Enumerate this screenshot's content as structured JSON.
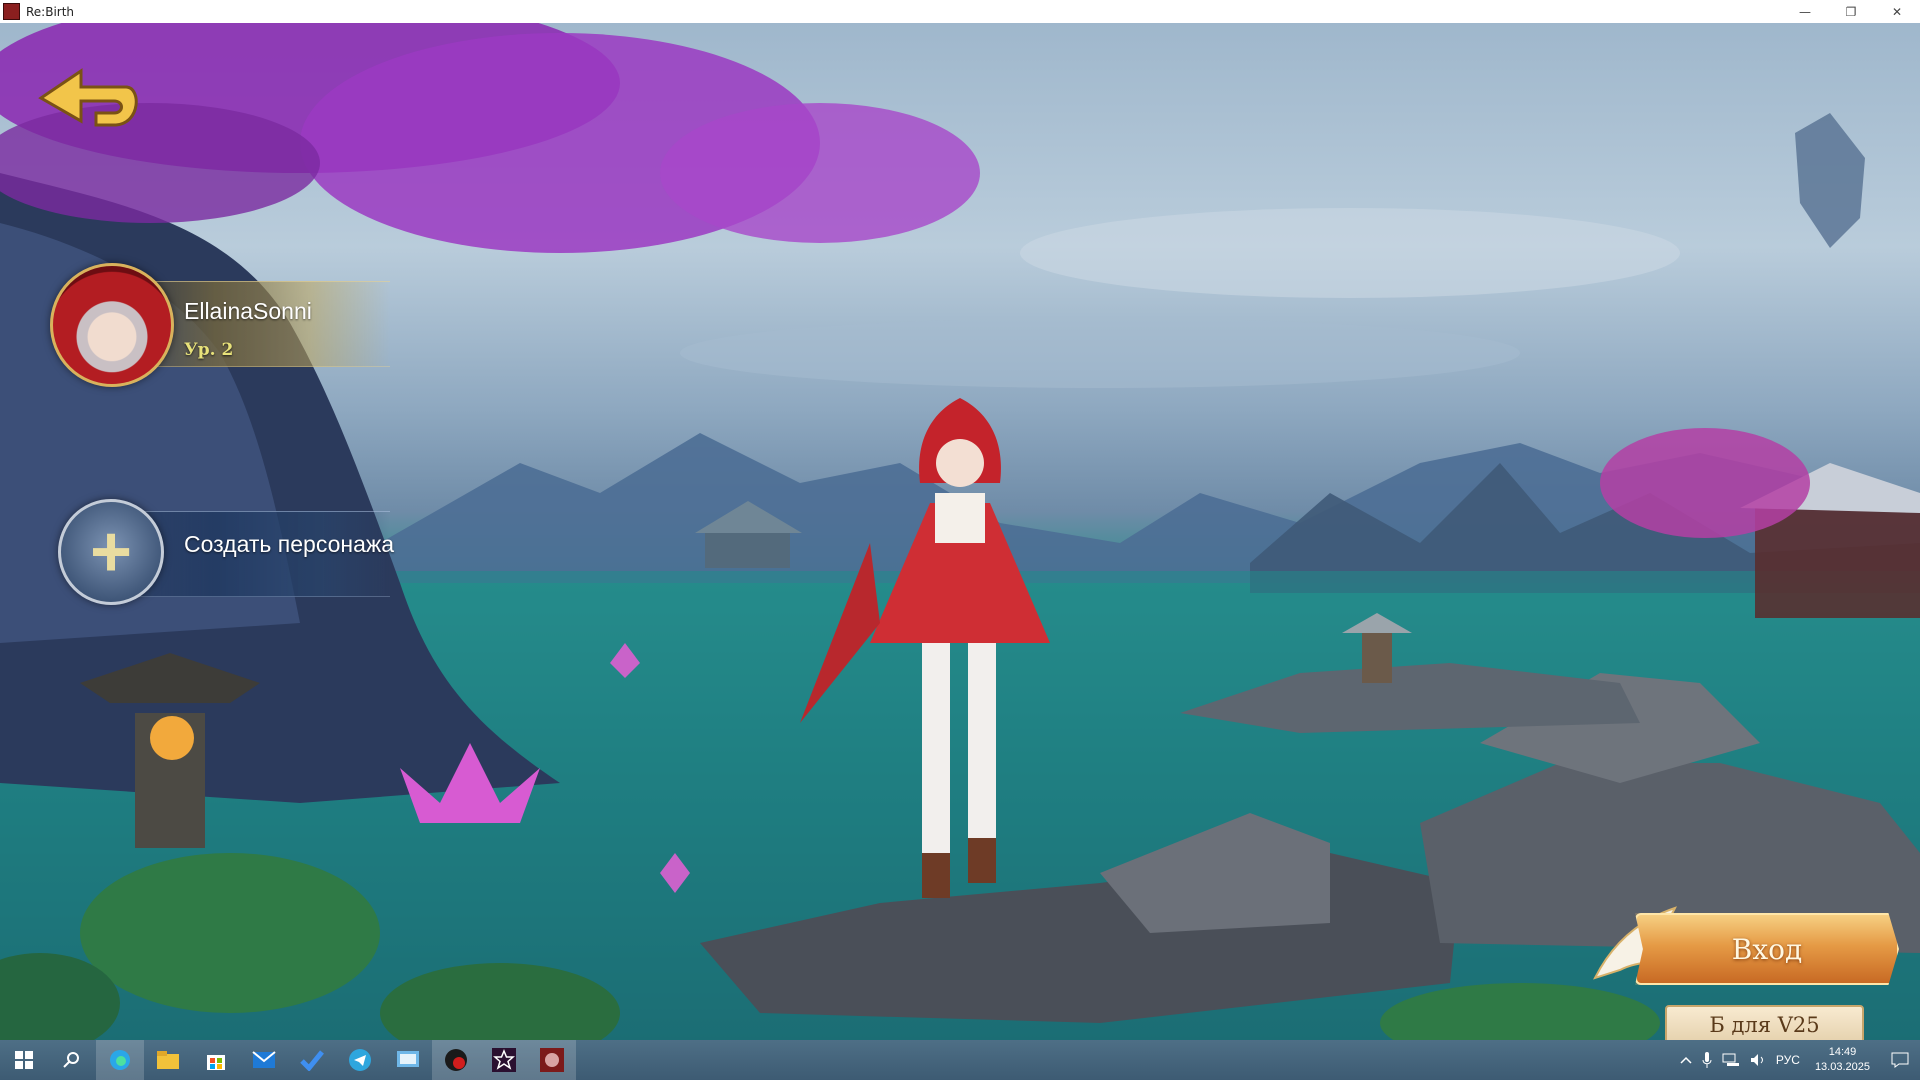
{
  "window": {
    "title": "Re:Birth",
    "minimize": "—",
    "restore": "❐",
    "close": "✕"
  },
  "game": {
    "characters": [
      {
        "name": "EllainaSonni",
        "level": "Ур. 2"
      }
    ],
    "create_slot": {
      "label": "Создать персонажа"
    },
    "enter_button": {
      "label": "Вход"
    },
    "server_tag": {
      "label": "Б для V25"
    }
  },
  "taskbar": {
    "apps": [
      "start-icon",
      "search-icon",
      "edge-icon",
      "file-explorer-icon",
      "store-icon",
      "mail-icon",
      "ms-todo-icon",
      "telegram-icon",
      "control-panel-icon",
      "app-red-dot-icon",
      "star-app-icon",
      "rebirth-app-icon"
    ],
    "tray": {
      "language": "РУС",
      "time": "14:49",
      "date": "13.03.2025"
    }
  },
  "colors": {
    "enter_button": "#e59a45",
    "level_text": "#e8e27a",
    "taskbar": "#3d5b73"
  }
}
